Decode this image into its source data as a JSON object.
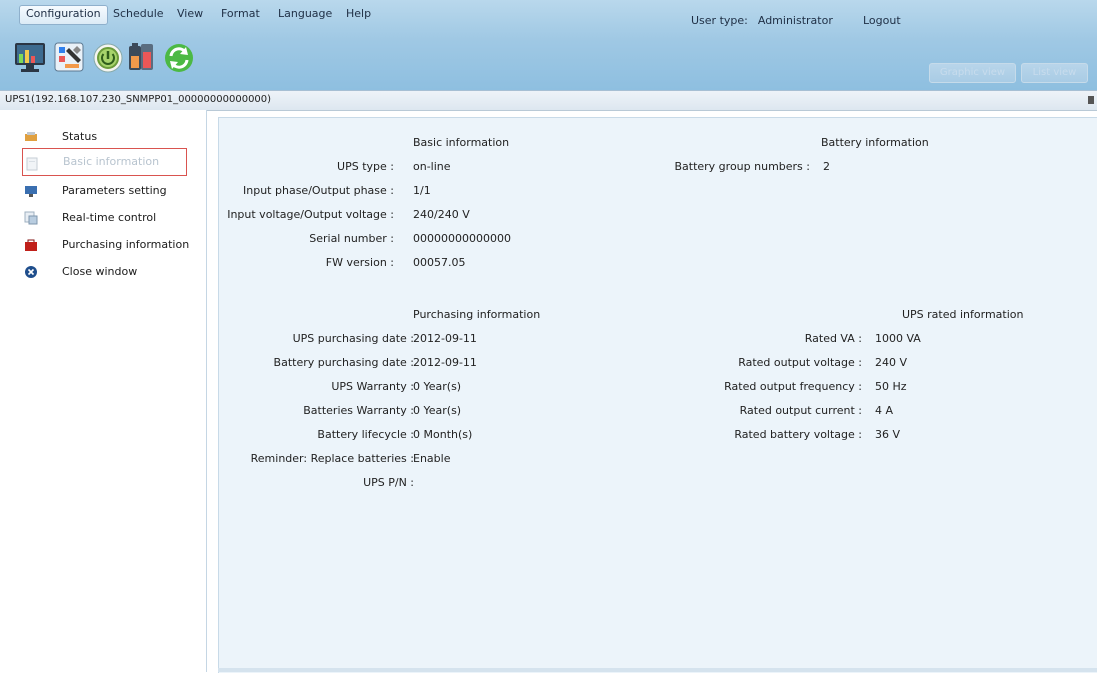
{
  "menu": {
    "configuration": "Configuration",
    "schedule": "Schedule",
    "view": "View",
    "format": "Format",
    "language": "Language",
    "help": "Help"
  },
  "user": {
    "type_label": "User type:",
    "type_value": "Administrator",
    "logout": "Logout"
  },
  "toolbar": {
    "graphic_view": "Graphic view",
    "list_view": "List view"
  },
  "device": {
    "title": "UPS1(192.168.107.230_SNMPP01_00000000000000)"
  },
  "sidebar": {
    "items": [
      {
        "label": "Status"
      },
      {
        "label": "Basic information"
      },
      {
        "label": "Parameters setting"
      },
      {
        "label": "Real-time control"
      },
      {
        "label": "Purchasing information"
      },
      {
        "label": "Close window"
      }
    ]
  },
  "basic": {
    "title": "Basic information",
    "rows": [
      {
        "label": "UPS type :",
        "value": "on-line"
      },
      {
        "label": "Input phase/Output phase :",
        "value": "1/1"
      },
      {
        "label": "Input voltage/Output voltage :",
        "value": "240/240 V"
      },
      {
        "label": "Serial number :",
        "value": "00000000000000"
      },
      {
        "label": "FW version :",
        "value": "00057.05"
      }
    ]
  },
  "battery": {
    "title": "Battery information",
    "rows": [
      {
        "label": "Battery group numbers :",
        "value": "2"
      }
    ]
  },
  "purchasing": {
    "title": "Purchasing information",
    "rows": [
      {
        "label": "UPS purchasing date :",
        "value": "2012-09-11"
      },
      {
        "label": "Battery purchasing date :",
        "value": "2012-09-11"
      },
      {
        "label": "UPS Warranty :",
        "value": "0 Year(s)"
      },
      {
        "label": "Batteries Warranty :",
        "value": "0 Year(s)"
      },
      {
        "label": "Battery lifecycle :",
        "value": "0 Month(s)"
      },
      {
        "label": "Reminder: Replace batteries :",
        "value": "Enable"
      },
      {
        "label": "UPS P/N :",
        "value": ""
      }
    ]
  },
  "rated": {
    "title": "UPS rated information",
    "rows": [
      {
        "label": "Rated VA :",
        "value": "1000 VA"
      },
      {
        "label": "Rated output voltage :",
        "value": "240 V"
      },
      {
        "label": "Rated output frequency :",
        "value": "50 Hz"
      },
      {
        "label": "Rated output current :",
        "value": "4 A"
      },
      {
        "label": "Rated battery voltage :",
        "value": "36 V"
      }
    ]
  }
}
